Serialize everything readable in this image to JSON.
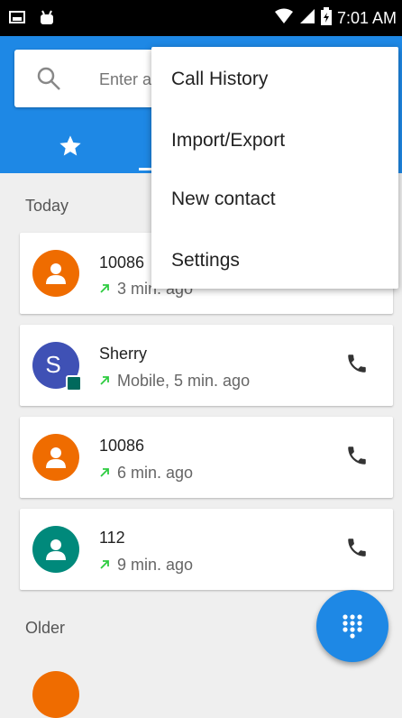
{
  "status_bar": {
    "time": "7:01 AM"
  },
  "search": {
    "placeholder": "Enter a"
  },
  "sections": {
    "today": "Today",
    "older": "Older"
  },
  "calls": [
    {
      "name": "10086",
      "detail": "3 min. ago",
      "avatar_color": "#ef6c00",
      "avatar_type": "person-icon"
    },
    {
      "name": "Sherry",
      "detail": "Mobile, 5 min. ago",
      "avatar_color": "#3f51b5",
      "avatar_letter": "S"
    },
    {
      "name": "10086",
      "detail": "6 min. ago",
      "avatar_color": "#ef6c00",
      "avatar_type": "person-icon"
    },
    {
      "name": "112",
      "detail": "9 min. ago",
      "avatar_color": "#00897b",
      "avatar_type": "person-icon"
    }
  ],
  "menu": {
    "items": [
      "Call History",
      "Import/Export",
      "New contact",
      "Settings"
    ]
  },
  "colors": {
    "primary": "#1e88e5",
    "outgoing_arrow": "#2ecc40",
    "orange": "#ef6c00",
    "teal": "#00897b",
    "indigo": "#3f51b5"
  }
}
